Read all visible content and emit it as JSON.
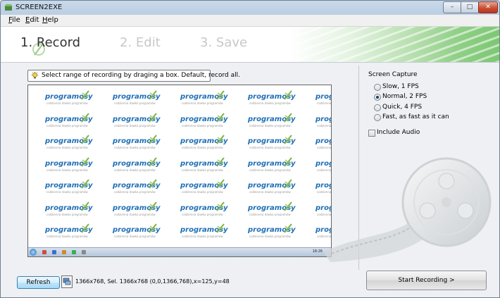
{
  "window": {
    "title": "SCREEN2EXE",
    "controls": {
      "minimize": "–",
      "maximize": "□",
      "close": "✕"
    }
  },
  "menu": {
    "items": [
      "File",
      "Edit",
      "Help"
    ]
  },
  "steps": {
    "record": "1. Record",
    "edit": "2. Edit",
    "save": "3. Save"
  },
  "hint": {
    "text": "Select range of recording by draging a box. Default, record all.",
    "icon": "lightbulb-icon"
  },
  "preview": {
    "logo_text": "programosy",
    "logo_tagline": "codzienna dawka programów",
    "taskbar_clock": "18:26"
  },
  "capture": {
    "title": "Screen Capture",
    "options": [
      {
        "label": "Slow, 1 FPS",
        "checked": false
      },
      {
        "label": "Normal, 2 FPS",
        "checked": true
      },
      {
        "label": "Quick, 4 FPS",
        "checked": false
      },
      {
        "label": "Fast, as fast as it can",
        "checked": false
      }
    ],
    "include_audio_label": "Include Audio",
    "include_audio_checked": false
  },
  "bottom": {
    "refresh_label": "Refresh",
    "status": "1366x768, Sel. 1366x768 (0,0,1366,768),x=125,y=48",
    "start_label": "Start Recording >"
  },
  "colors": {
    "accent_green": "#7cc773",
    "logo_blue": "#1f6fb5",
    "refresh_blue": "#bee6fd"
  }
}
